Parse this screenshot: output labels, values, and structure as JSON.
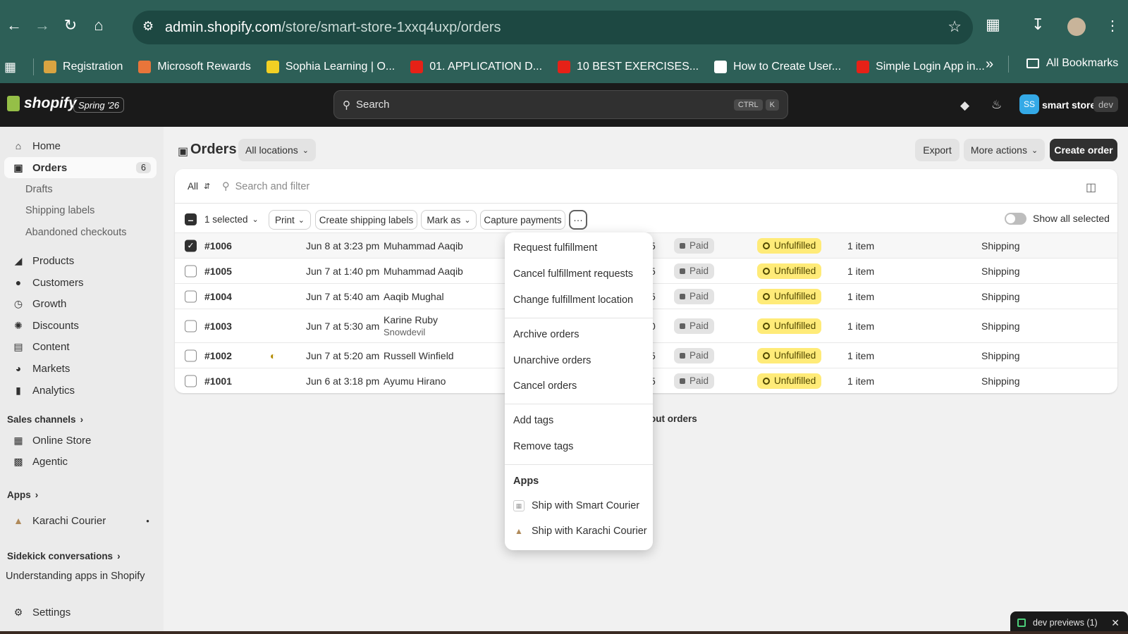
{
  "browser": {
    "url_host": "admin.shopify.com",
    "url_path": "/store/smart-store-1xxq4uxp/orders",
    "bookmarks": [
      {
        "label": "Registration",
        "color": "#d9a441"
      },
      {
        "label": "Microsoft Rewards",
        "color": "#e8753a"
      },
      {
        "label": "Sophia Learning | O...",
        "color": "#f2d024"
      },
      {
        "label": "01. APPLICATION D...",
        "color": "#e62117"
      },
      {
        "label": "10 BEST EXERCISES...",
        "color": "#e62117"
      },
      {
        "label": "How to Create User...",
        "color": "#ffffff"
      },
      {
        "label": "Simple Login App in...",
        "color": "#e62117"
      }
    ],
    "more_bookmarks": "»",
    "all_bookmarks": "All Bookmarks"
  },
  "header": {
    "logo": "shopify",
    "edition": "Spring '26",
    "search_placeholder": "Search",
    "kbd_ctrl": "CTRL",
    "kbd_k": "K",
    "avatar_initials": "SS",
    "store_name": "smart store",
    "store_tag": "dev"
  },
  "sidebar": {
    "home": "Home",
    "orders": "Orders",
    "orders_count": "6",
    "drafts": "Drafts",
    "shipping_labels": "Shipping labels",
    "abandoned": "Abandoned checkouts",
    "products": "Products",
    "customers": "Customers",
    "growth": "Growth",
    "discounts": "Discounts",
    "content": "Content",
    "markets": "Markets",
    "analytics": "Analytics",
    "sales_channels": "Sales channels",
    "online_store": "Online Store",
    "agentic": "Agentic",
    "apps": "Apps",
    "karachi_courier": "Karachi Courier",
    "sidekick": "Sidekick conversations",
    "sidekick_item": "Understanding apps in Shopify",
    "settings": "Settings"
  },
  "page": {
    "title": "Orders",
    "locations": "All locations",
    "export": "Export",
    "more_actions": "More actions",
    "create_order": "Create order"
  },
  "filter": {
    "tab": "All",
    "search_placeholder": "Search and filter",
    "selected": "1 selected",
    "print": "Print",
    "create_labels": "Create shipping labels",
    "mark_as": "Mark as",
    "capture": "Capture payments",
    "more": "···",
    "show_all": "Show all selected"
  },
  "orders": [
    {
      "id": "#1006",
      "date": "Jun 8 at 3:23 pm",
      "customer": "Muhammad Aaqib",
      "customer2": "",
      "total_tail": "5",
      "payment": "Paid",
      "fulfillment": "Unfulfilled",
      "items": "1 item",
      "delivery": "Shipping",
      "checked": true
    },
    {
      "id": "#1005",
      "date": "Jun 7 at 1:40 pm",
      "customer": "Muhammad Aaqib",
      "customer2": "",
      "total_tail": "5",
      "payment": "Paid",
      "fulfillment": "Unfulfilled",
      "items": "1 item",
      "delivery": "Shipping",
      "checked": false
    },
    {
      "id": "#1004",
      "date": "Jun 7 at 5:40 am",
      "customer": "Aaqib Mughal",
      "customer2": "",
      "total_tail": "5",
      "payment": "Paid",
      "fulfillment": "Unfulfilled",
      "items": "1 item",
      "delivery": "Shipping",
      "checked": false
    },
    {
      "id": "#1003",
      "date": "Jun 7 at 5:30 am",
      "customer": "Karine Ruby",
      "customer2": "Snowdevil",
      "total_tail": "0",
      "payment": "Paid",
      "fulfillment": "Unfulfilled",
      "items": "1 item",
      "delivery": "Shipping",
      "checked": false
    },
    {
      "id": "#1002",
      "date": "Jun 7 at 5:20 am",
      "customer": "Russell Winfield",
      "customer2": "",
      "total_tail": "5",
      "payment": "Paid",
      "fulfillment": "Unfulfilled",
      "items": "1 item",
      "delivery": "Shipping",
      "checked": false
    },
    {
      "id": "#1001",
      "date": "Jun 6 at 3:18 pm",
      "customer": "Ayumu Hirano",
      "customer2": "",
      "total_tail": "5",
      "payment": "Paid",
      "fulfillment": "Unfulfilled",
      "items": "1 item",
      "delivery": "Shipping",
      "checked": false
    }
  ],
  "learn_more_tail": "out orders",
  "menu": {
    "request": "Request fulfillment",
    "cancel_requests": "Cancel fulfillment requests",
    "change_location": "Change fulfillment location",
    "archive": "Archive orders",
    "unarchive": "Unarchive orders",
    "cancel_orders": "Cancel orders",
    "add_tags": "Add tags",
    "remove_tags": "Remove tags",
    "apps_heading": "Apps",
    "ship_smart": "Ship with Smart Courier",
    "ship_karachi": "Ship with Karachi Courier"
  },
  "dev_previews": "dev previews (1)"
}
